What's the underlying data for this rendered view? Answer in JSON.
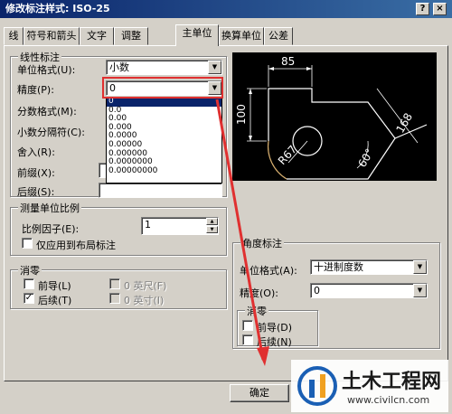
{
  "window": {
    "title": "修改标注样式: ISO-25",
    "help_label": "?",
    "close_label": "×"
  },
  "tabs": [
    {
      "label": "线"
    },
    {
      "label": "符号和箭头"
    },
    {
      "label": "文字"
    },
    {
      "label": "调整"
    },
    {
      "label": "主单位"
    },
    {
      "label": "换算单位"
    },
    {
      "label": "公差"
    }
  ],
  "linear": {
    "group_title": "线性标注",
    "unit_format_label": "单位格式(U):",
    "unit_format_value": "小数",
    "precision_label": "精度(P):",
    "precision_value": "0",
    "fraction_format_label": "分数格式(M):",
    "decimal_separator_label": "小数分隔符(C):",
    "round_off_label": "舍入(R):",
    "prefix_label": "前缀(X):",
    "suffix_label": "后缀(S):"
  },
  "precision_options": [
    "0",
    "0.0",
    "0.00",
    "0.000",
    "0.0000",
    "0.00000",
    "0.000000",
    "0.0000000",
    "0.00000000"
  ],
  "scale": {
    "group_title": "测量单位比例",
    "factor_label": "比例因子(E):",
    "factor_value": "1",
    "layout_only_label": "仅应用到布局标注"
  },
  "zero_suppression": {
    "group_title": "消零",
    "leading_label": "前导(L)",
    "leading_checked": false,
    "trailing_label": "后续(T)",
    "trailing_checked": true,
    "feet_label": "0 英尺(F)",
    "inches_label": "0 英寸(I)"
  },
  "angular": {
    "group_title": "角度标注",
    "unit_format_label": "单位格式(A):",
    "unit_format_value": "十进制度数",
    "precision_label": "精度(O):",
    "precision_value": "0",
    "zero_title": "消零",
    "leading_label": "前导(D)",
    "trailing_label": "后续(N)"
  },
  "preview": {
    "dim_top": "85",
    "dim_left": "100",
    "dim_right": "168",
    "dim_radius": "R67",
    "dim_angle": "60°"
  },
  "ok_label": "确定",
  "watermark": {
    "brand": "土木工程网",
    "url": "www.civilcn.com"
  },
  "colors": {
    "highlight": "#0a246a",
    "annotation_red": "#e03030",
    "brand_blue": "#1a5fb4"
  }
}
